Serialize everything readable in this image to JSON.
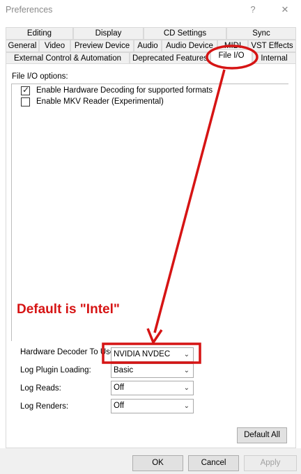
{
  "window": {
    "title": "Preferences",
    "help_icon": "?",
    "close_icon": "✕"
  },
  "tabs_row1": [
    "Editing",
    "Display",
    "CD Settings",
    "Sync"
  ],
  "tabs_row2": [
    "General",
    "Video",
    "Preview Device",
    "Audio",
    "Audio Device",
    "MIDI",
    "VST Effects"
  ],
  "tabs_row3": [
    "External Control & Automation",
    "Deprecated Features",
    "File I/O",
    "Internal"
  ],
  "active_tab": "File I/O",
  "section_label": "File I/O options:",
  "options": [
    {
      "label": "Enable Hardware Decoding for supported formats",
      "checked": true
    },
    {
      "label": "Enable MKV Reader (Experimental)",
      "checked": false
    }
  ],
  "annotation": "Default is \"Intel\"",
  "fields": [
    {
      "label": "Hardware Decoder To Use:",
      "value": "NVIDIA NVDEC"
    },
    {
      "label": "Log Plugin Loading:",
      "value": "Basic"
    },
    {
      "label": "Log Reads:",
      "value": "Off"
    },
    {
      "label": "Log Renders:",
      "value": "Off"
    }
  ],
  "buttons": {
    "default_all": "Default All",
    "ok": "OK",
    "cancel": "Cancel",
    "apply": "Apply"
  },
  "colors": {
    "annotation_red": "#d61414",
    "border": "#d9d9d9",
    "button_face": "#e1e1e1"
  }
}
